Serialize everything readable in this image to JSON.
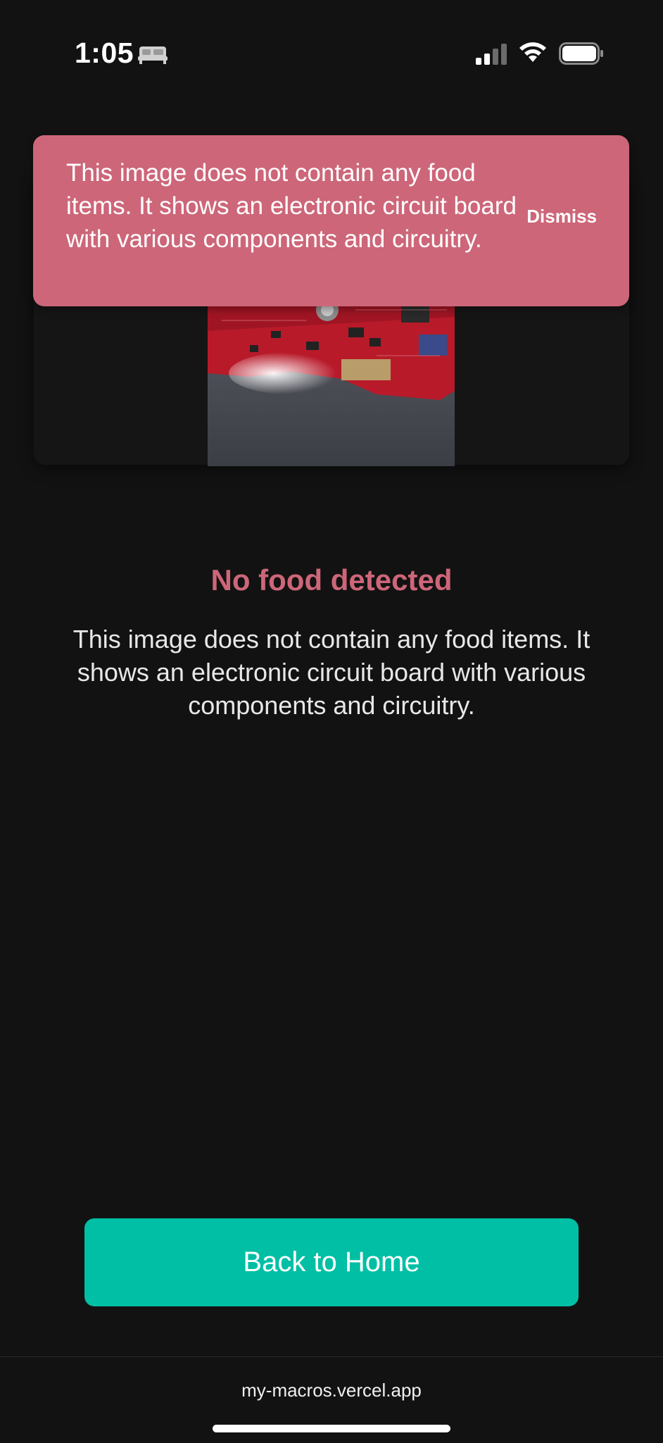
{
  "status_bar": {
    "time": "1:05",
    "focus_icon": "bed-icon",
    "signal_icon": "cellular-signal-icon",
    "wifi_icon": "wifi-icon",
    "battery_icon": "battery-icon"
  },
  "toast": {
    "message": "This image does not contain any food items. It shows an electronic circuit board with various components and circuitry.",
    "dismiss_label": "Dismiss",
    "background_color": "#cd6679"
  },
  "photo": {
    "subject_icon": "circuit-board-photo"
  },
  "result": {
    "title": "No food detected",
    "description": "This image does not contain any food items. It shows an electronic circuit board with various components and circuitry.",
    "title_color": "#cd6679"
  },
  "actions": {
    "home_label": "Back to Home",
    "accent_color": "#00bfa5"
  },
  "browser": {
    "url": "my-macros.vercel.app"
  }
}
